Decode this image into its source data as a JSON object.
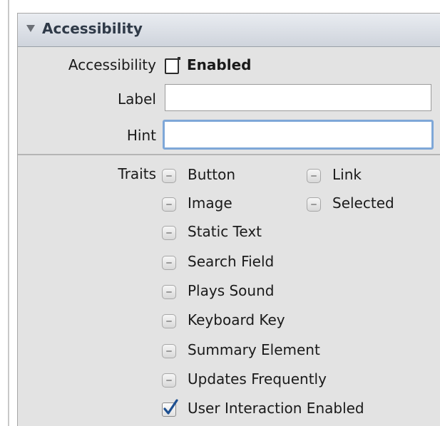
{
  "header": {
    "title": "Accessibility"
  },
  "accessibility": {
    "label": "Accessibility",
    "checkbox_label": "Enabled",
    "checked": false
  },
  "fields": {
    "label": {
      "label": "Label",
      "value": ""
    },
    "hint": {
      "label": "Hint",
      "value": ""
    }
  },
  "traits": {
    "label": "Traits",
    "left": [
      {
        "label": "Button",
        "checked": false
      },
      {
        "label": "Image",
        "checked": false
      },
      {
        "label": "Static Text",
        "checked": false
      },
      {
        "label": "Search Field",
        "checked": false
      },
      {
        "label": "Plays Sound",
        "checked": false
      },
      {
        "label": "Keyboard Key",
        "checked": false
      },
      {
        "label": "Summary Element",
        "checked": false
      },
      {
        "label": "Updates Frequently",
        "checked": false
      },
      {
        "label": "User Interaction Enabled",
        "checked": true
      }
    ],
    "right": [
      {
        "label": "Link",
        "checked": false
      },
      {
        "label": "Selected",
        "checked": false
      }
    ]
  },
  "colors": {
    "panel": "#e3e3e3",
    "header_text": "#2f3a48",
    "focus_ring": "#7ea7d8",
    "checkmark": "#1d4f91"
  }
}
